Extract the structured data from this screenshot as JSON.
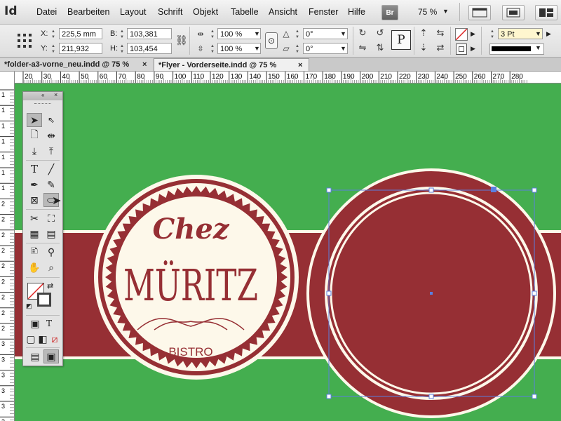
{
  "app": {
    "logo": "Id"
  },
  "menu": {
    "items": [
      "Datei",
      "Bearbeiten",
      "Layout",
      "Schrift",
      "Objekt",
      "Tabelle",
      "Ansicht",
      "Fenster",
      "Hilfe"
    ]
  },
  "menubar_right": {
    "br_label": "Br",
    "zoom": "75 %"
  },
  "control": {
    "x_label": "X:",
    "x_value": "225,5 mm",
    "y_label": "Y:",
    "y_value": "211,932 mm",
    "b_label": "B:",
    "b_value": "103,381 mm",
    "h_label": "H:",
    "h_value": "103,454 mm",
    "scale_x": "100 %",
    "scale_y": "100 %",
    "rotate": "0°",
    "shear": "0°",
    "stroke_weight": "3 Pt"
  },
  "tabs": [
    {
      "label": "*folder-a3-vorne_neu.indd @ 75 %",
      "close": "×"
    },
    {
      "label": "*Flyer - Vorderseite.indd @ 75 %",
      "close": "×"
    }
  ],
  "ruler": {
    "h_numbers": [
      "20",
      "30",
      "40",
      "50",
      "60",
      "70",
      "80",
      "90",
      "100",
      "110",
      "120",
      "130",
      "140",
      "150",
      "160",
      "170",
      "180",
      "190",
      "200",
      "210",
      "220",
      "230",
      "240",
      "250",
      "260",
      "270",
      "280"
    ],
    "v_numbers": [
      "1",
      "1",
      "1",
      "1",
      "1",
      "1",
      "1",
      "2",
      "2",
      "2",
      "2",
      "2",
      "2",
      "2",
      "2",
      "2",
      "3",
      "3",
      "3",
      "3",
      "3",
      "3"
    ]
  },
  "artwork": {
    "script_text": "Chez",
    "title_text": "MÜRITZ",
    "subtitle_text": "BISTRO"
  },
  "colors": {
    "canvas_green": "#44ae4f",
    "band_red": "#962f34",
    "cream": "#fdf8ea",
    "selection_blue": "#5b7fe0"
  },
  "icons": [
    "id-logo",
    "bridge-icon",
    "view-options-icon",
    "screen-mode-icon",
    "arrange-icon",
    "reference-point-icon",
    "constrain-proportions-icon",
    "rotate-icon",
    "shear-icon",
    "flip-icon",
    "stroke-swatch-icon",
    "fill-swatch-icon"
  ]
}
